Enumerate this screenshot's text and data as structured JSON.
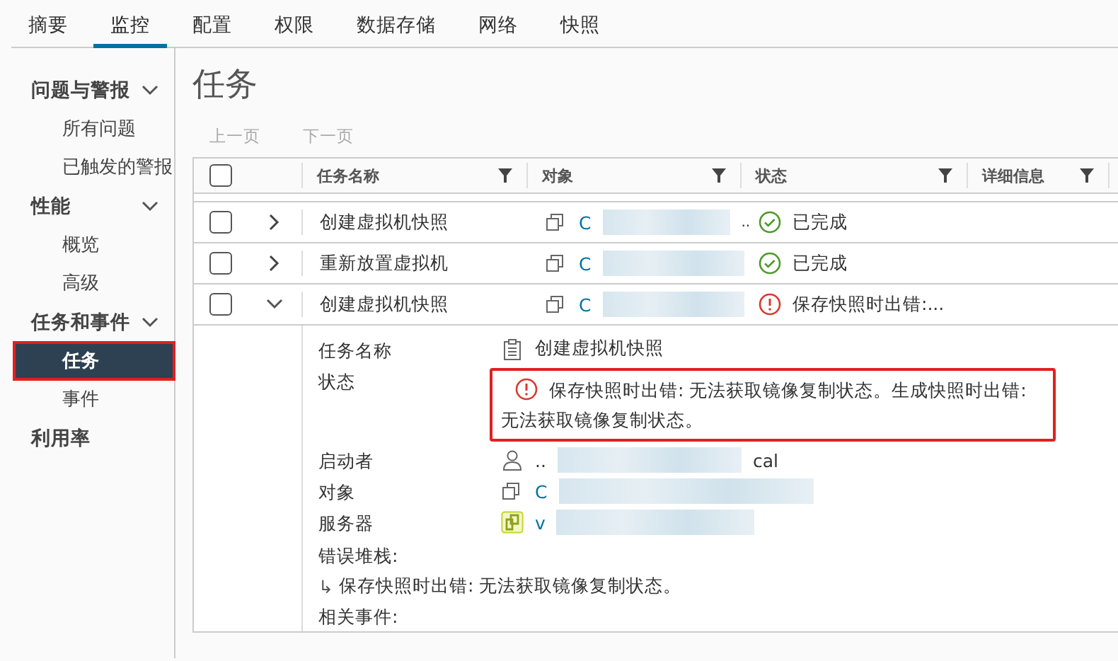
{
  "tabs": [
    {
      "label": "摘要",
      "selected": false
    },
    {
      "label": "监控",
      "selected": true
    },
    {
      "label": "配置",
      "selected": false
    },
    {
      "label": "权限",
      "selected": false
    },
    {
      "label": "数据存储",
      "selected": false
    },
    {
      "label": "网络",
      "selected": false
    },
    {
      "label": "快照",
      "selected": false
    }
  ],
  "sidebar": {
    "groups": [
      {
        "label": "问题与警报",
        "expanded": true,
        "items": [
          {
            "label": "所有问题",
            "selected": false,
            "annotated": false
          },
          {
            "label": "已触发的警报",
            "selected": false,
            "annotated": false
          }
        ]
      },
      {
        "label": "性能",
        "expanded": true,
        "items": [
          {
            "label": "概览",
            "selected": false,
            "annotated": false
          },
          {
            "label": "高级",
            "selected": false,
            "annotated": false
          }
        ]
      },
      {
        "label": "任务和事件",
        "expanded": true,
        "items": [
          {
            "label": "任务",
            "selected": true,
            "annotated": true
          },
          {
            "label": "事件",
            "selected": false,
            "annotated": false
          }
        ]
      },
      {
        "label": "利用率"
      }
    ]
  },
  "page": {
    "title": "任务",
    "pagination": [
      {
        "label": "上一页",
        "disabled": true
      },
      {
        "label": "下一页",
        "disabled": true
      }
    ]
  },
  "table": {
    "select_all_checked": false,
    "columns": [
      {
        "label": "任务名称",
        "filter": true
      },
      {
        "label": "对象",
        "filter": true
      },
      {
        "label": "状态",
        "filter": true
      },
      {
        "label": "详细信息",
        "filter": true
      }
    ],
    "rows": [
      {
        "checked": false,
        "expanded": false,
        "name": "创建虚拟机快照",
        "object": "C",
        "object_suffix": "..",
        "status": {
          "kind": "success",
          "text": "已完成"
        }
      },
      {
        "checked": false,
        "expanded": false,
        "name": "重新放置虚拟机",
        "object": "C",
        "status": {
          "kind": "success",
          "text": "已完成"
        }
      },
      {
        "checked": false,
        "expanded": true,
        "name": "创建虚拟机快照",
        "object": "C",
        "status": {
          "kind": "error",
          "text": "保存快照时出错:..."
        }
      }
    ]
  },
  "detail": {
    "fields": [
      {
        "kind": "task",
        "label": "任务名称",
        "value": "创建虚拟机快照"
      },
      {
        "kind": "error",
        "label": "状态",
        "value": "保存快照时出错: 无法获取镜像复制状态。生成快照时出错: 无法获取镜像复制状态。",
        "annotated": true
      },
      {
        "kind": "user",
        "label": "启动者",
        "value": "..",
        "value_suffix": "cal"
      },
      {
        "kind": "vm",
        "label": "对象",
        "value": "C"
      },
      {
        "kind": "host",
        "label": "服务器",
        "value": "v"
      }
    ],
    "stack_label": "错误堆栈:",
    "stack_arrow": "↳",
    "stack_text": "保存快照时出错: 无法获取镜像复制状态。",
    "related_label": "相关事件:"
  }
}
